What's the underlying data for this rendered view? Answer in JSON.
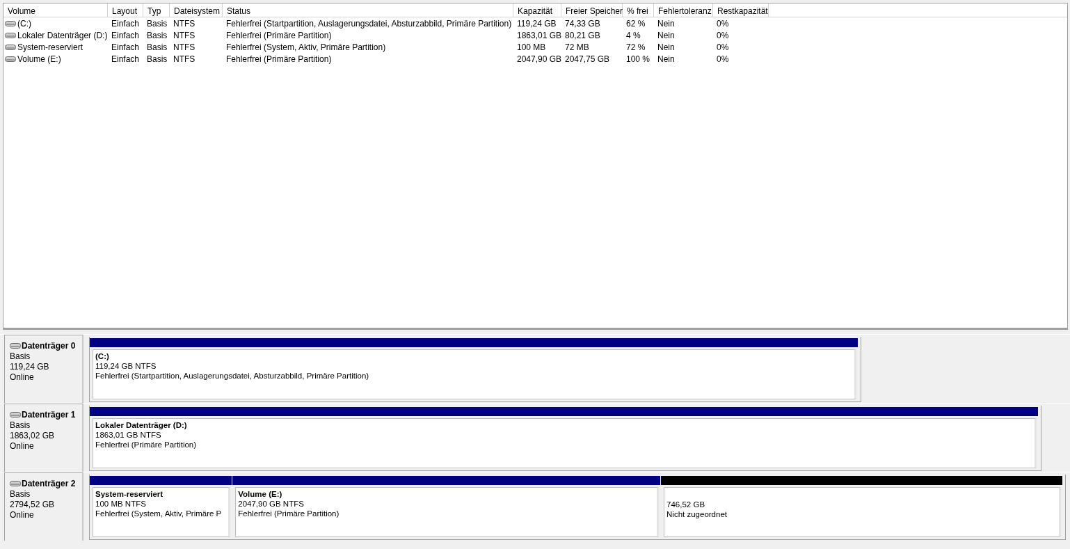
{
  "volume_list": {
    "columns": [
      "Volume",
      "Layout",
      "Typ",
      "Dateisystem",
      "Status",
      "Kapazität",
      "Freier Speicher",
      "% frei",
      "Fehlertoleranz",
      "Restkapazität"
    ],
    "rows": [
      [
        "(C:)",
        "Einfach",
        "Basis",
        "NTFS",
        "Fehlerfrei (Startpartition, Auslagerungsdatei, Absturzabbild, Primäre Partition)",
        "119,24 GB",
        "74,33 GB",
        "62 %",
        "Nein",
        "0%"
      ],
      [
        "Lokaler Datenträger (D:)",
        "Einfach",
        "Basis",
        "NTFS",
        "Fehlerfrei (Primäre Partition)",
        "1863,01 GB",
        "80,21 GB",
        "4 %",
        "Nein",
        "0%"
      ],
      [
        "System-reserviert",
        "Einfach",
        "Basis",
        "NTFS",
        "Fehlerfrei (System, Aktiv, Primäre Partition)",
        "100 MB",
        "72 MB",
        "72 %",
        "Nein",
        "0%"
      ],
      [
        "Volume (E:)",
        "Einfach",
        "Basis",
        "NTFS",
        "Fehlerfrei (Primäre Partition)",
        "2047,90 GB",
        "2047,75 GB",
        "100 %",
        "Nein",
        "0%"
      ]
    ]
  },
  "disks": [
    {
      "name": "Datenträger 0",
      "type": "Basis",
      "size": "119,24 GB",
      "state": "Online",
      "partitions": [
        {
          "kind": "primary",
          "name": "(C:)",
          "size": "119,24 GB NTFS",
          "status": "Fehlerfrei (Startpartition, Auslagerungsdatei, Absturzabbild, Primäre Partition)"
        }
      ]
    },
    {
      "name": "Datenträger 1",
      "type": "Basis",
      "size": "1863,02 GB",
      "state": "Online",
      "partitions": [
        {
          "kind": "primary",
          "name": "Lokaler Datenträger  (D:)",
          "size": "1863,01 GB NTFS",
          "status": "Fehlerfrei (Primäre Partition)"
        }
      ]
    },
    {
      "name": "Datenträger 2",
      "type": "Basis",
      "size": "2794,52 GB",
      "state": "Online",
      "partitions": [
        {
          "kind": "primary",
          "name": "System-reserviert",
          "size": "100 MB NTFS",
          "status": "Fehlerfrei (System, Aktiv, Primäre P"
        },
        {
          "kind": "primary",
          "name": "Volume  (E:)",
          "size": "2047,90 GB NTFS",
          "status": "Fehlerfrei (Primäre Partition)"
        },
        {
          "kind": "unallocated",
          "size": "746,52 GB",
          "status": "Nicht zugeordnet"
        }
      ]
    }
  ]
}
